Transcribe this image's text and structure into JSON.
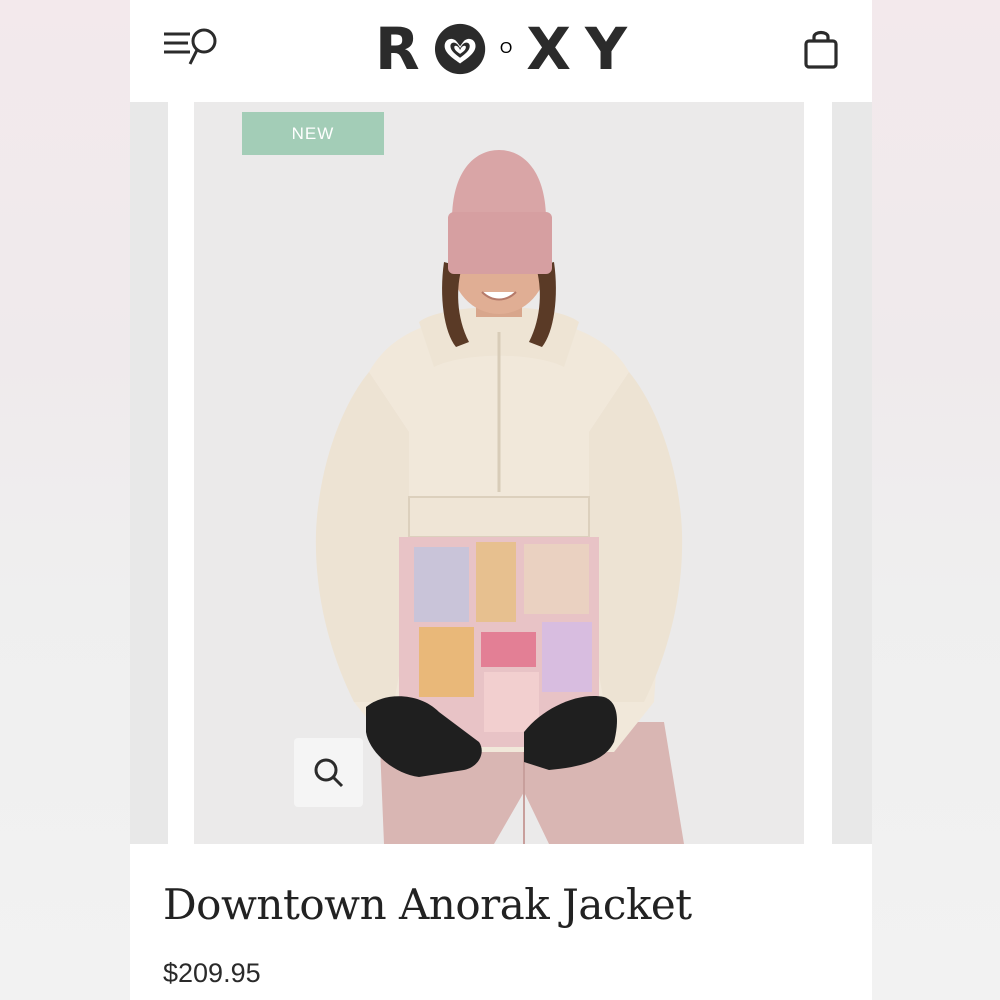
{
  "header": {
    "logo_letters": [
      "R",
      "X",
      "Y"
    ],
    "logo_middle_letter": "O",
    "menu_icon": "menu-search-icon",
    "bag_icon": "shopping-bag-icon"
  },
  "carousel": {
    "badge_label": "NEW",
    "zoom_icon": "magnifier-icon"
  },
  "product": {
    "title": "Downtown Anorak Jacket",
    "price": "$209.95"
  },
  "colors": {
    "badge": "#a3cdb7",
    "text": "#2b2b2b"
  }
}
